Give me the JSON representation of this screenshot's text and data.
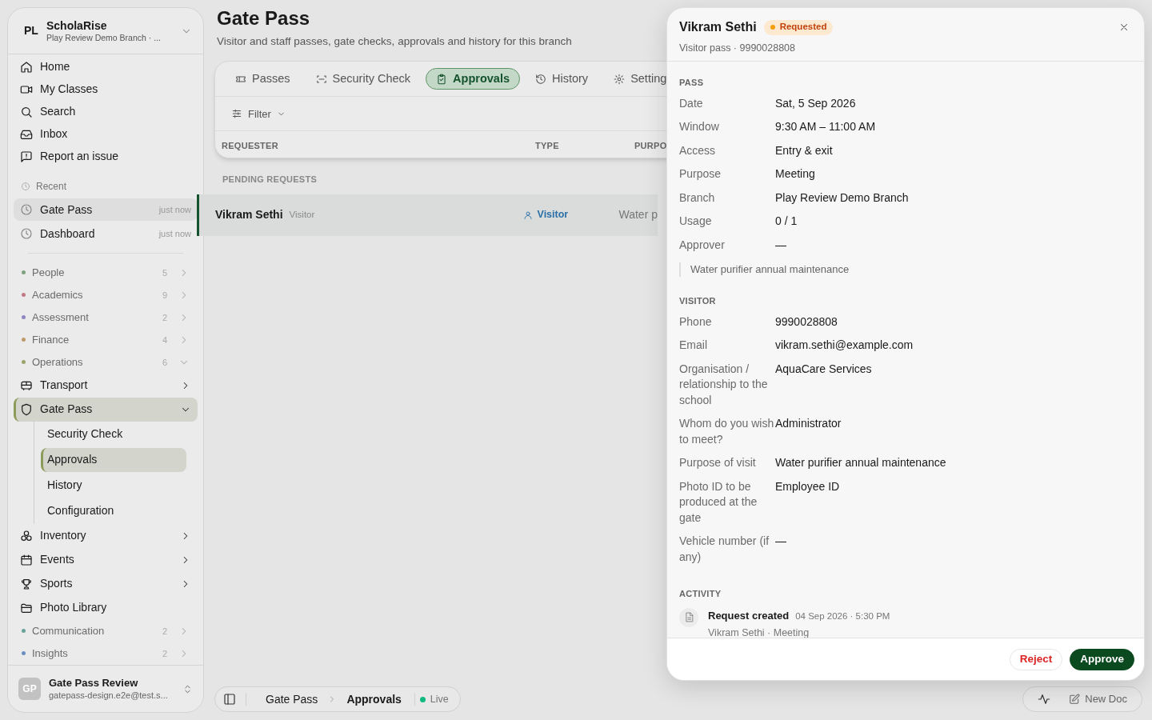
{
  "workspace": {
    "initials": "PL",
    "name": "ScholaRise",
    "branch": "Play Review Demo Branch · ..."
  },
  "nav": [
    {
      "label": "Home"
    },
    {
      "label": "My Classes"
    },
    {
      "label": "Search"
    },
    {
      "label": "Inbox"
    },
    {
      "label": "Report an issue"
    }
  ],
  "recent": {
    "label": "Recent",
    "items": [
      {
        "label": "Gate Pass",
        "time": "just now",
        "selected": true
      },
      {
        "label": "Dashboard",
        "time": "just now",
        "selected": false
      }
    ]
  },
  "groups": [
    {
      "label": "People",
      "color": "#7fa37f",
      "count": "5",
      "expanded": false
    },
    {
      "label": "Academics",
      "color": "#c07b86",
      "count": "9",
      "expanded": false
    },
    {
      "label": "Assessment",
      "color": "#8f86c0",
      "count": "2",
      "expanded": false
    },
    {
      "label": "Finance",
      "color": "#c09a6b",
      "count": "4",
      "expanded": false
    },
    {
      "label": "Operations",
      "color": "#9aa36b",
      "count": "6",
      "expanded": true,
      "children": [
        {
          "label": "Transport",
          "kind": "section",
          "expanded": false,
          "selected": false
        },
        {
          "label": "Gate Pass",
          "kind": "section",
          "expanded": true,
          "selected": true,
          "children": [
            {
              "label": "Security Check",
              "selected": false
            },
            {
              "label": "Approvals",
              "selected": true
            },
            {
              "label": "History",
              "selected": false
            },
            {
              "label": "Configuration",
              "selected": false
            }
          ]
        },
        {
          "label": "Inventory",
          "kind": "section",
          "expanded": false,
          "selected": false
        },
        {
          "label": "Events",
          "kind": "section",
          "expanded": false,
          "selected": false
        },
        {
          "label": "Sports",
          "kind": "section",
          "expanded": false,
          "selected": false
        },
        {
          "label": "Photo Library",
          "kind": "link",
          "expanded": false,
          "selected": false
        }
      ]
    },
    {
      "label": "Communication",
      "color": "#6ba39a",
      "count": "2",
      "expanded": false
    },
    {
      "label": "Insights",
      "color": "#6b8fc0",
      "count": "2",
      "expanded": false
    }
  ],
  "user": {
    "initials": "GP",
    "name": "Gate Pass Review",
    "email": "gatepass-design.e2e@test.s..."
  },
  "page": {
    "title": "Gate Pass",
    "subtitle": "Visitor and staff passes, gate checks, approvals and history for this branch"
  },
  "tabs": [
    {
      "label": "Passes",
      "selected": false
    },
    {
      "label": "Security Check",
      "selected": false
    },
    {
      "label": "Approvals",
      "selected": true
    },
    {
      "label": "History",
      "selected": false
    },
    {
      "label": "Setting",
      "selected": false
    }
  ],
  "filter": {
    "label": "Filter"
  },
  "table": {
    "columns": [
      "REQUESTER",
      "TYPE",
      "PURPO"
    ],
    "groups": [
      {
        "label": "PENDING REQUESTS",
        "rows": [
          {
            "name": "Vikram Sethi",
            "subtitle": "Visitor",
            "type": "Visitor",
            "purpose": "Water p",
            "selected": true
          }
        ]
      }
    ]
  },
  "breadcrumb": {
    "items": [
      "Gate Pass",
      "Approvals"
    ],
    "status": "Live"
  },
  "dock": {
    "new_doc": "New Doc"
  },
  "drawer": {
    "title": "Vikram Sethi",
    "status": "Requested",
    "subtitle": "Visitor pass · 9990028808",
    "sections": [
      {
        "heading": "PASS",
        "fields": [
          {
            "label": "Date",
            "value": "Sat, 5 Sep 2026"
          },
          {
            "label": "Window",
            "value": "9:30 AM – 11:00 AM"
          },
          {
            "label": "Access",
            "value": "Entry & exit"
          },
          {
            "label": "Purpose",
            "value": "Meeting"
          },
          {
            "label": "Branch",
            "value": "Play Review Demo Branch"
          },
          {
            "label": "Usage",
            "value": "0 / 1"
          },
          {
            "label": "Approver",
            "value": "—"
          }
        ],
        "note": "Water purifier annual maintenance"
      },
      {
        "heading": "VISITOR",
        "fields": [
          {
            "label": "Phone",
            "value": "9990028808"
          },
          {
            "label": "Email",
            "value": "vikram.sethi@example.com"
          },
          {
            "label": "Organisation / relationship to the school",
            "value": "AquaCare Services"
          },
          {
            "label": "Whom do you wish to meet?",
            "value": "Administrator"
          },
          {
            "label": "Purpose of visit",
            "value": "Water purifier annual maintenance"
          },
          {
            "label": "Photo ID to be produced at the gate",
            "value": "Employee ID"
          },
          {
            "label": "Vehicle number (if any)",
            "value": "—"
          }
        ]
      }
    ],
    "activity": {
      "heading": "ACTIVITY",
      "items": [
        {
          "title": "Request created",
          "time": "04 Sep 2026 · 5:30 PM",
          "detail": "Vikram Sethi · Meeting"
        }
      ]
    },
    "actions": [
      {
        "label": "Reject",
        "kind": "secondary"
      },
      {
        "label": "Approve",
        "kind": "primary"
      }
    ]
  }
}
